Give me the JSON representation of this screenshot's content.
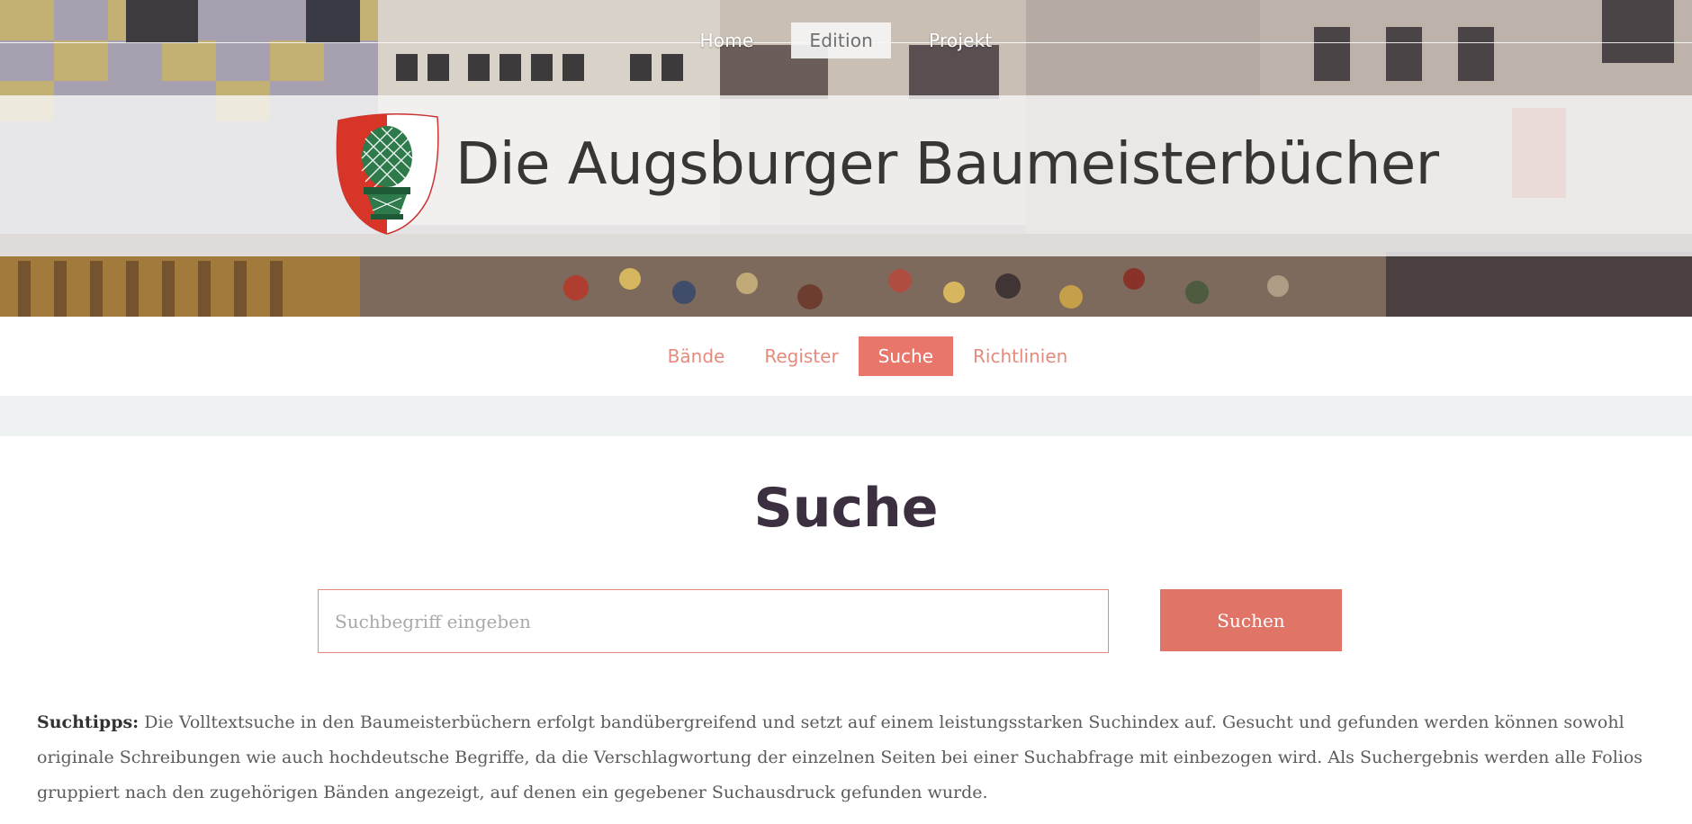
{
  "top_nav": {
    "items": [
      {
        "label": "Home",
        "active": false
      },
      {
        "label": "Edition",
        "active": true
      },
      {
        "label": "Projekt",
        "active": false
      }
    ]
  },
  "header": {
    "title": "Die Augsburger Baumeisterbücher",
    "logo_icon": "augsburg-coat-of-arms-icon"
  },
  "sub_nav": {
    "items": [
      {
        "label": "Bände",
        "active": false
      },
      {
        "label": "Register",
        "active": false
      },
      {
        "label": "Suche",
        "active": true
      },
      {
        "label": "Richtlinien",
        "active": false
      }
    ]
  },
  "main": {
    "title": "Suche",
    "search": {
      "placeholder": "Suchbegriff eingeben",
      "value": "",
      "button_label": "Suchen"
    },
    "tips": {
      "label": "Suchtipps:",
      "text": "Die Volltextsuche in den Baumeisterbüchern erfolgt bandübergreifend und setzt auf einem leistungsstarken Suchindex auf. Gesucht und gefunden werden können sowohl originale Schreibungen wie auch hochdeutsche Begriffe, da die Verschlagwortung der einzelnen Seiten bei einer Suchabfrage mit einbezogen wird. Als Suchergebnis werden alle Folios gruppiert nach den zugehörigen Bänden angezeigt, auf denen ein gegebener Suchausdruck gefunden wurde."
    }
  },
  "colors": {
    "accent": "#e07466",
    "accent_light": "#e48b7e",
    "title_text": "#383634",
    "heading_text": "#3c3040",
    "strip": "#eff2f2"
  }
}
